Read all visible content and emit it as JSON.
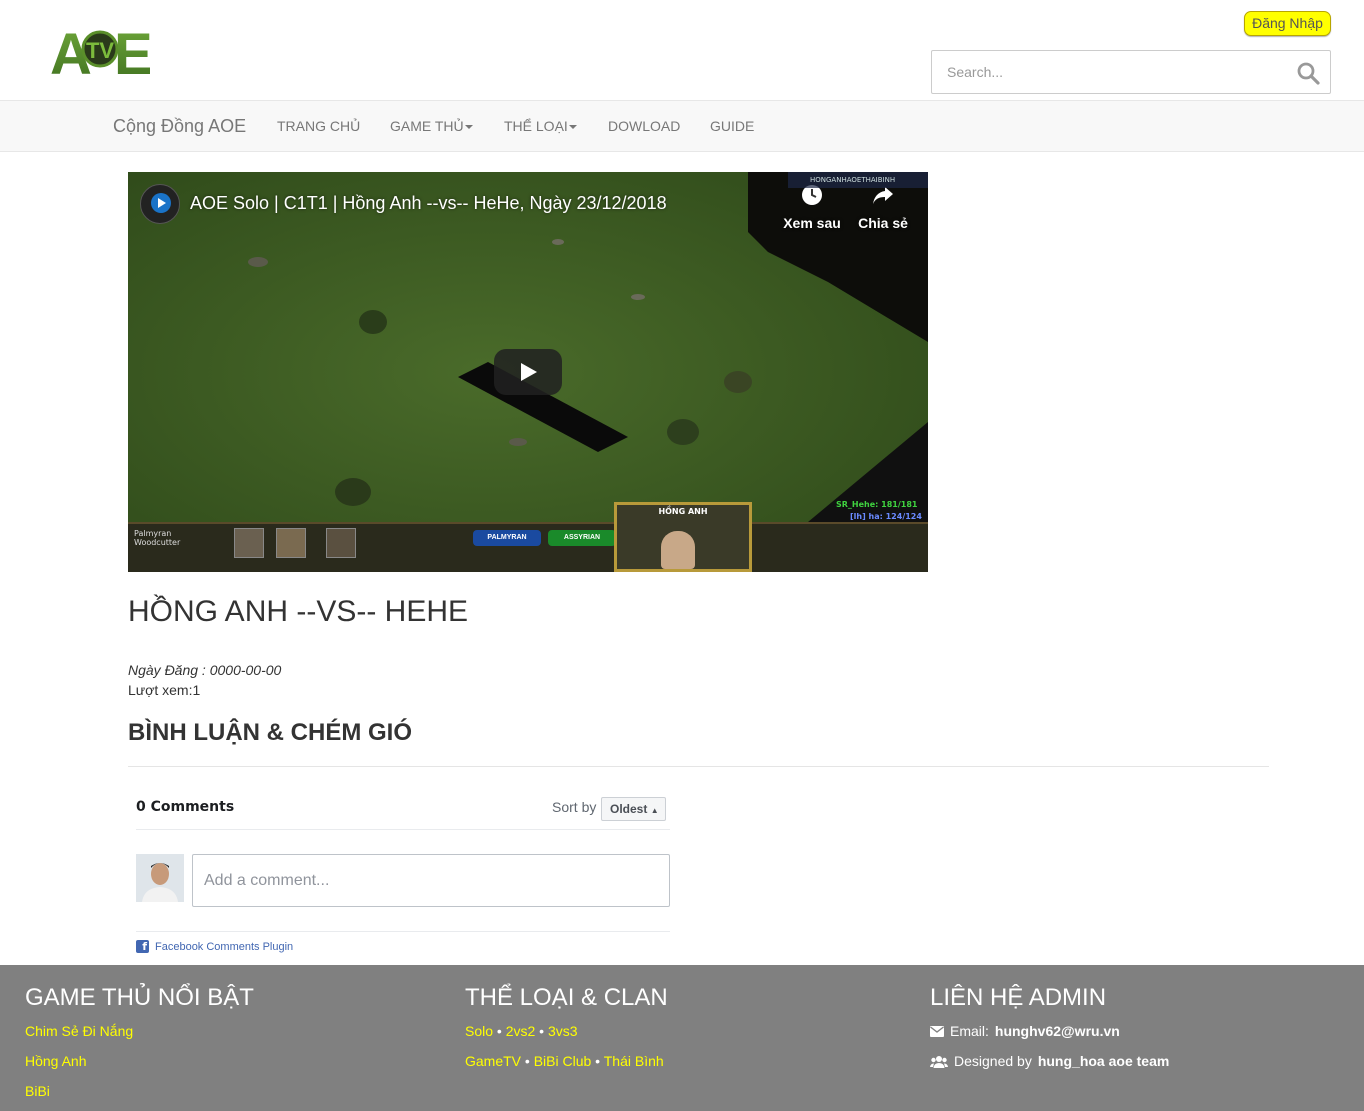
{
  "header": {
    "logo_text": "ATVE",
    "login_label": "Đăng Nhập",
    "search_placeholder": "Search..."
  },
  "nav": {
    "brand": "Cộng Đồng AOE",
    "items": [
      {
        "label": "TRANG CHỦ",
        "dropdown": false
      },
      {
        "label": "GAME THỦ",
        "dropdown": true
      },
      {
        "label": "THỂ LOẠI",
        "dropdown": true
      },
      {
        "label": "DOWLOAD",
        "dropdown": false
      },
      {
        "label": "GUIDE",
        "dropdown": false
      }
    ]
  },
  "video": {
    "title": "AOE Solo | C1T1 | Hồng Anh --vs-- HeHe, Ngày 23/12/2018",
    "watch_later_label": "Xem sau",
    "share_label": "Chia sẻ",
    "hud": {
      "unit_line1": "Palmyran",
      "unit_line2": "Woodcutter",
      "civ_left": "PALMYRAN",
      "civ_right": "ASSYRIAN",
      "player_name": "HỒNG ANH",
      "score_line1": "SR_Hehe: 181/181",
      "score_line2": "[lh] ha: 124/124",
      "channel_overlay": "HONGANHAOETHAIBINH"
    }
  },
  "post": {
    "title": "HỒNG ANH --VS-- HEHE",
    "date_label": "Ngày Đăng : 0000-00-00",
    "views_label": "Lượt xem:1"
  },
  "comments": {
    "heading": "BÌNH LUẬN & CHÉM GIÓ",
    "count_label": "0 Comments",
    "sort_label": "Sort by",
    "sort_value": "Oldest",
    "input_placeholder": "Add a comment...",
    "plugin_label": "Facebook Comments Plugin"
  },
  "footer": {
    "players_heading": "GAME THỦ NỔI BẬT",
    "players": [
      "Chim Sẻ Đi Nắng",
      "Hồng Anh",
      "BiBi"
    ],
    "categories_heading": "THỂ LOẠI & CLAN",
    "categories_row1": [
      "Solo",
      "2vs2",
      "3vs3"
    ],
    "categories_row2": [
      "GameTV",
      "BiBi Club",
      "Thái Bình"
    ],
    "separator": " • ",
    "contact_heading": "LIÊN HỆ ADMIN",
    "email_prefix": "Email:",
    "email": "hunghv62@wru.vn",
    "designed_prefix": "Designed by",
    "designed_by": "hung_hoa aoe team"
  },
  "colors": {
    "login_button": "#ffff00",
    "footer_bg": "#808080",
    "footer_link": "#ffff00",
    "navbar_bg": "#f8f8f8",
    "facebook_blue": "#4267b2"
  },
  "icons": {
    "search": "search-icon",
    "watch_later": "clock-icon",
    "share": "share-arrow-icon",
    "play": "play-icon",
    "email": "envelope-icon",
    "designer": "users-icon",
    "facebook": "facebook-icon"
  }
}
